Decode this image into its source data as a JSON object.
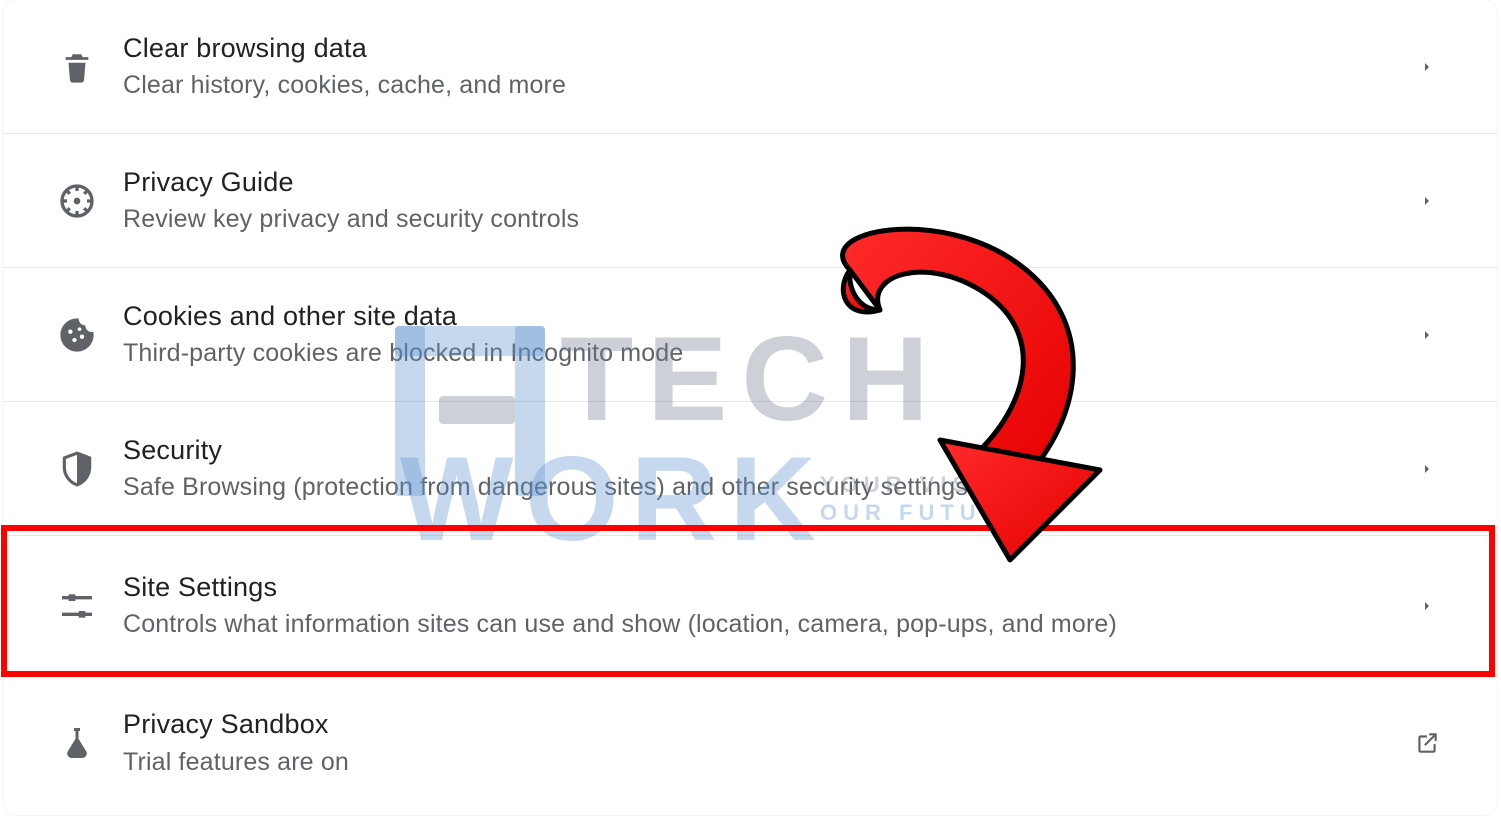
{
  "settings": {
    "items": [
      {
        "id": "clear-browsing-data",
        "icon": "trash-icon",
        "title": "Clear browsing data",
        "desc": "Clear history, cookies, cache, and more",
        "end": "chevron"
      },
      {
        "id": "privacy-guide",
        "icon": "compass-icon",
        "title": "Privacy Guide",
        "desc": "Review key privacy and security controls",
        "end": "chevron"
      },
      {
        "id": "cookies",
        "icon": "cookie-icon",
        "title": "Cookies and other site data",
        "desc": "Third-party cookies are blocked in Incognito mode",
        "end": "chevron"
      },
      {
        "id": "security",
        "icon": "shield-icon",
        "title": "Security",
        "desc": "Safe Browsing (protection from dangerous sites) and other security settings",
        "end": "chevron"
      },
      {
        "id": "site-settings",
        "icon": "sliders-icon",
        "title": "Site Settings",
        "desc": "Controls what information sites can use and show (location, camera, pop-ups, and more)",
        "end": "chevron",
        "highlighted": true
      },
      {
        "id": "privacy-sandbox",
        "icon": "flask-icon",
        "title": "Privacy Sandbox",
        "desc": "Trial features are on",
        "end": "open-in-new"
      }
    ]
  },
  "annotations": {
    "highlight_color": "#ff0000",
    "arrow_color": "#ff0000"
  },
  "watermark": {
    "line1": "TECH",
    "line2": "WORK",
    "tag1": "YOUR VISION",
    "tag2": "OUR FUTURE"
  }
}
